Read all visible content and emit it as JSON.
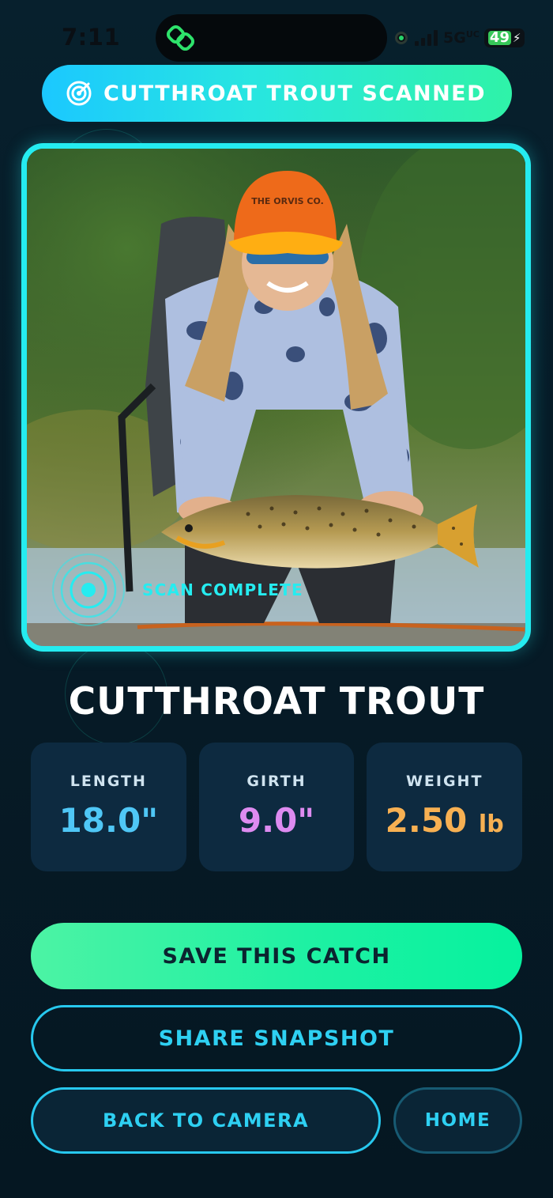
{
  "status_bar": {
    "time": "7:11",
    "network": "5G",
    "network_suffix": "UC",
    "battery_percent": "49",
    "battery_charging": true
  },
  "banner": {
    "icon": "radar-icon",
    "label": "CUTTHROAT TROUT SCANNED"
  },
  "photo": {
    "scan_status": "SCAN COMPLETE",
    "scan_icon": "sonar-target-icon",
    "cap_text": "THE ORVIS CO."
  },
  "species": {
    "name": "CUTTHROAT TROUT"
  },
  "stats": [
    {
      "label": "LENGTH",
      "value": "18.0\"",
      "unit": "",
      "color": "#4fc7f6"
    },
    {
      "label": "GIRTH",
      "value": "9.0\"",
      "unit": "",
      "color": "#dd8bf0"
    },
    {
      "label": "WEIGHT",
      "value": "2.50",
      "unit": "lb",
      "color": "#f7b052"
    }
  ],
  "actions": {
    "save": "SAVE THIS CATCH",
    "share": "SHARE SNAPSHOT",
    "back": "BACK TO CAMERA",
    "home": "HOME"
  },
  "colors": {
    "accent_cyan": "#25ecf0",
    "accent_green": "#06f29e",
    "background": "#061b27",
    "card": "#0d2a40"
  }
}
